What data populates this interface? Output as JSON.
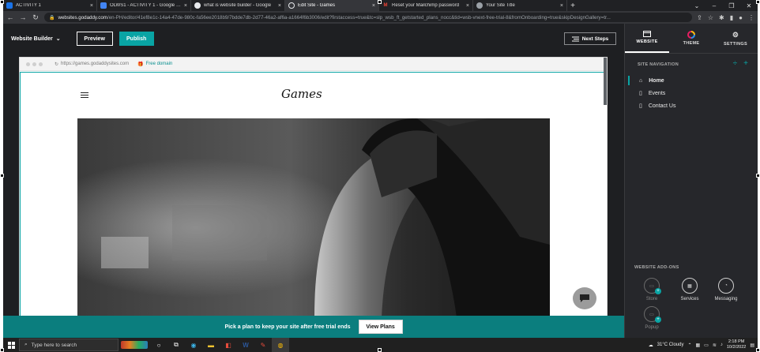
{
  "browser": {
    "tabs": [
      {
        "title": "ACTIVITY 1",
        "color": "#1a73e8"
      },
      {
        "title": "OLWS1 - ACTIVITY 1 - Google Do",
        "color": "#4285f4"
      },
      {
        "title": "what is website builder - Google",
        "color": "#e8eaed"
      },
      {
        "title": "Edit Site - Games",
        "color": "#e8eaed"
      },
      {
        "title": "Reset your Mailchimp password",
        "color": "#ea4335"
      },
      {
        "title": "Your Site Title",
        "color": "#9aa0a6"
      }
    ],
    "active_tab": 3,
    "url_host": "websites.godaddy.com",
    "url_path": "/en-PH/editor/41ef8e1c-14a4-47de-980c-fa56ee2018b9/7bdde7db-2d77-46a2-af6a-a1664f6b3006/edit?firstaccess=true&tc=slp_wsb_ft_getstarted_plans_nocc&tid=wsb-vnext-free-trial-8&fromOnboarding=true&skipDesignGallery=tr..."
  },
  "editor": {
    "brand": "Website Builder",
    "preview_label": "Preview",
    "publish_label": "Publish",
    "next_steps_label": "Next Steps",
    "preview_url": "https://games.godaddysites.com",
    "free_domain_label": "Free domain",
    "site_title": "Games",
    "banner_text": "Pick a plan to keep your site after free trial ends",
    "view_plans_label": "View Plans",
    "accent": "#09a4a4"
  },
  "panel": {
    "tabs": [
      {
        "label": "WEBSITE",
        "icon": "website-icon"
      },
      {
        "label": "THEME",
        "icon": "theme-icon"
      },
      {
        "label": "SETTINGS",
        "icon": "gear-icon"
      }
    ],
    "active_tab": "WEBSITE",
    "site_nav_label": "SITE NAVIGATION",
    "pages": [
      {
        "label": "Home",
        "icon": "home-icon"
      },
      {
        "label": "Events",
        "icon": "page-icon"
      },
      {
        "label": "Contact Us",
        "icon": "page-icon"
      }
    ],
    "addons_label": "WEBSITE ADD-ONS",
    "addons": [
      {
        "label": "Store",
        "icon": "store-icon"
      },
      {
        "label": "Services",
        "icon": "calendar-icon"
      },
      {
        "label": "Messaging",
        "icon": "chat-icon"
      },
      {
        "label": "Popup",
        "icon": "popup-icon"
      }
    ]
  },
  "taskbar": {
    "search_placeholder": "Type here to search",
    "weather": "31°C  Cloudy",
    "time": "2:18 PM",
    "date": "10/2/2022"
  }
}
